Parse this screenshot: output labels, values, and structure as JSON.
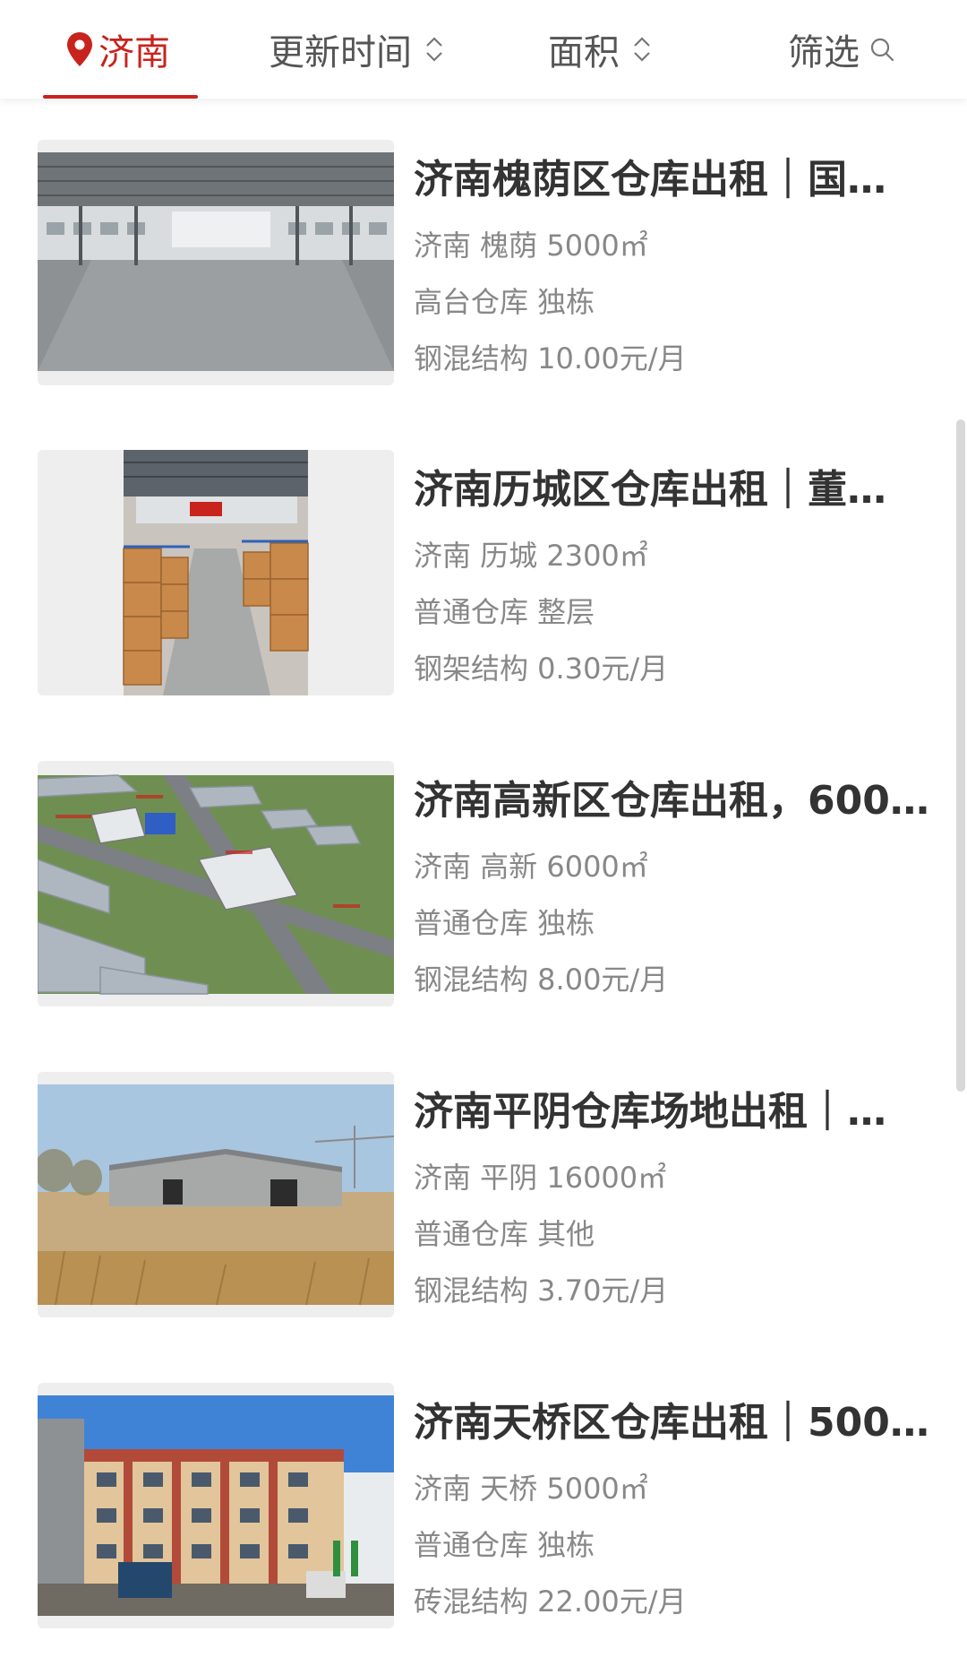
{
  "filters": {
    "city": "济南",
    "update_time": "更新时间",
    "area": "面积",
    "filter": "筛选"
  },
  "colors": {
    "accent": "#c8231c",
    "title_text": "#333333",
    "meta_text": "#888888"
  },
  "listings": [
    {
      "title": "济南槐荫区仓库出租｜国…",
      "location": "济南 槐荫 5000㎡",
      "type": "高台仓库 独栋",
      "price": "钢混结构 10.00元/月",
      "image": "warehouse-interior-empty"
    },
    {
      "title": "济南历城区仓库出租｜董…",
      "location": "济南 历城 2300㎡",
      "type": "普通仓库 整层",
      "price": "钢架结构 0.30元/月",
      "image": "warehouse-interior-boxes"
    },
    {
      "title": "济南高新区仓库出租，600…",
      "location": "济南 高新 6000㎡",
      "type": "普通仓库 独栋",
      "price": "钢混结构 8.00元/月",
      "image": "industrial-park-3d-render"
    },
    {
      "title": "济南平阴仓库场地出租｜…",
      "location": "济南 平阴 16000㎡",
      "type": "普通仓库 其他",
      "price": "钢混结构 3.70元/月",
      "image": "warehouse-exterior-field"
    },
    {
      "title": "济南天桥区仓库出租｜500…",
      "location": "济南 天桥 5000㎡",
      "type": "普通仓库 独栋",
      "price": "砖混结构 22.00元/月",
      "image": "factory-building-exterior"
    }
  ]
}
